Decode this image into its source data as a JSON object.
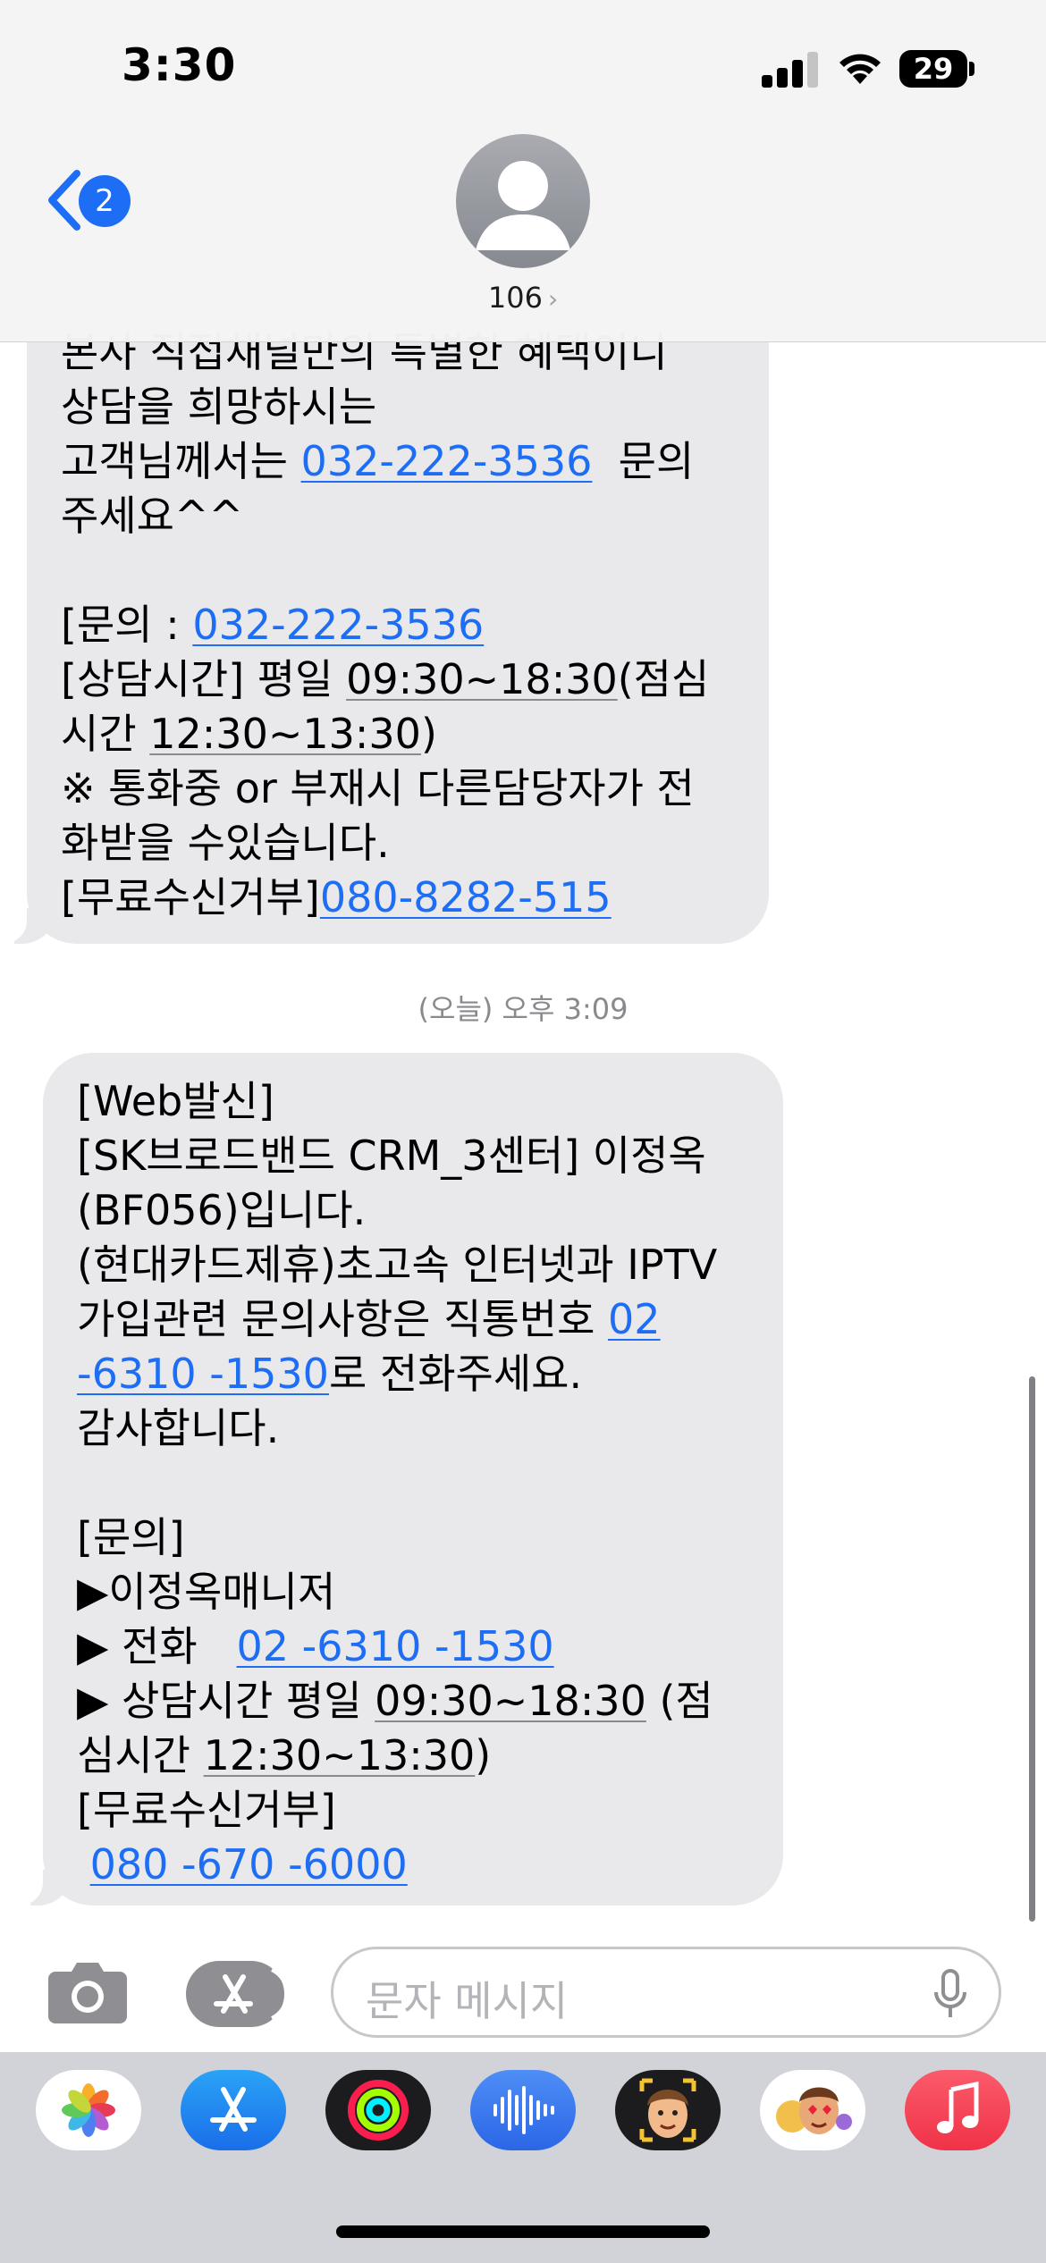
{
  "status_bar": {
    "time": "3:30",
    "battery": "29"
  },
  "header": {
    "back_badge": "2",
    "contact": "106",
    "contact_chevron": "›"
  },
  "thread": {
    "first_message_lines": [
      "본사 직접채널만의 특별한 혜택이니",
      "상담을 희망하시는",
      "고객님께서는 ",
      "032-222-3536",
      "  문의",
      "주세요^^",
      "[문의 : ",
      "032-222-3536",
      "[상담시간] 평일 ",
      "09:30~18:30",
      "(점심",
      "시간 ",
      "12:30~13:30",
      ")",
      "※ 통화중 or 부재시 다른담당자가 전",
      "화받을 수있습니다.",
      "[무료수신거부]",
      "080-8282-515"
    ],
    "timestamp": "(오늘) 오후 3:09",
    "second_message_lines": [
      "[Web발신]",
      "[SK브로드밴드 CRM_3센터] 이정옥",
      "(BF056)입니다.",
      "(현대카드제휴)초고속 인터넷과 IPTV",
      "가입관련 문의사항은 직통번호 ",
      "02",
      "-6310 -1530",
      "로 전화주세요.",
      "감사합니다.",
      "[문의]",
      "▶이정옥매니저",
      "▶ 전화   ",
      "02 -6310 -1530",
      "▶ 상담시간 평일 ",
      "09:30~18:30",
      " (점",
      "심시간 ",
      "12:30~13:30",
      ")",
      "[무료수신거부]",
      "080 -670 -6000"
    ]
  },
  "input": {
    "placeholder": "문자 메시지"
  },
  "colors": {
    "link": "#1e6ef5",
    "bubble": "#e9e9eb",
    "header_bg": "#f4f4f5"
  },
  "icons": {
    "camera": "camera-icon",
    "apps": "app-store-icon",
    "mic": "microphone-icon",
    "strip": [
      "photos-app-icon",
      "app-store-app-icon",
      "activity-app-icon",
      "audio-app-icon",
      "memoji-app-icon",
      "memoji-stickers-app-icon",
      "music-app-icon"
    ]
  }
}
